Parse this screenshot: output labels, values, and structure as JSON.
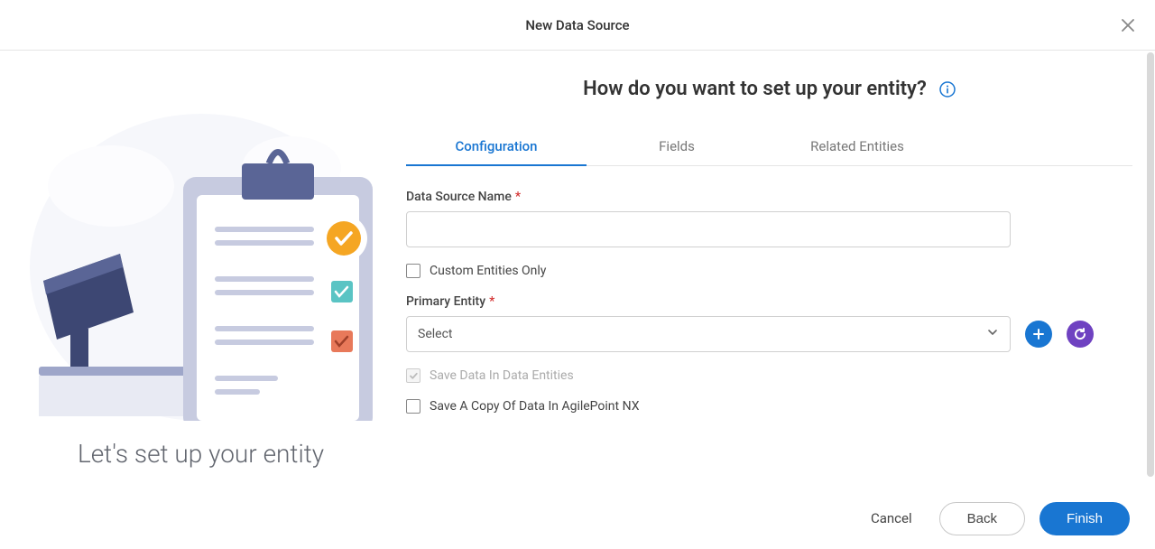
{
  "dialog": {
    "title": "New Data Source"
  },
  "left": {
    "caption": "Let's set up your entity"
  },
  "main": {
    "heading": "How do you want to set up your entity?",
    "tabs": [
      {
        "label": "Configuration"
      },
      {
        "label": "Fields"
      },
      {
        "label": "Related Entities"
      }
    ],
    "form": {
      "dataSourceName": {
        "label": "Data Source Name",
        "value": ""
      },
      "customEntitiesOnly": {
        "label": "Custom Entities Only"
      },
      "primaryEntity": {
        "label": "Primary Entity",
        "placeholder": "Select"
      },
      "saveDataInEntities": {
        "label": "Save Data In Data Entities"
      },
      "saveCopy": {
        "label": "Save A Copy Of Data In AgilePoint NX"
      }
    }
  },
  "footer": {
    "cancel": "Cancel",
    "back": "Back",
    "finish": "Finish"
  }
}
